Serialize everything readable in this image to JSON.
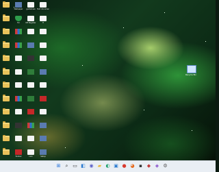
{
  "desktop": {
    "icons": [
      {
        "kind": "folder",
        "label": ""
      },
      {
        "kind": "img",
        "label": "Wallpaper"
      },
      {
        "kind": "doc",
        "label": "guidelines"
      },
      {
        "kind": "doc",
        "label": "Text document"
      },
      {
        "kind": "folder",
        "label": ""
      },
      {
        "kind": "shield",
        "label": "Tor"
      },
      {
        "kind": "doc",
        "label": "KB Register"
      },
      {
        "kind": "doc",
        "label": "H"
      },
      {
        "kind": "folder",
        "label": ""
      },
      {
        "kind": "multi",
        "label": ""
      },
      {
        "kind": "doc",
        "label": ""
      },
      {
        "kind": "doc",
        "label": ""
      },
      {
        "kind": "folder",
        "label": ""
      },
      {
        "kind": "multi",
        "label": ""
      },
      {
        "kind": "img",
        "label": ""
      },
      {
        "kind": "doc",
        "label": ""
      },
      {
        "kind": "folder",
        "label": ""
      },
      {
        "kind": "doc",
        "label": ""
      },
      {
        "kind": "dark",
        "label": ""
      },
      {
        "kind": "doc",
        "label": ""
      },
      {
        "kind": "folder",
        "label": ""
      },
      {
        "kind": "doc",
        "label": ""
      },
      {
        "kind": "green",
        "label": ""
      },
      {
        "kind": "img",
        "label": ""
      },
      {
        "kind": "folder",
        "label": ""
      },
      {
        "kind": "doc",
        "label": ""
      },
      {
        "kind": "doc",
        "label": ""
      },
      {
        "kind": "doc",
        "label": ""
      },
      {
        "kind": "folder",
        "label": ""
      },
      {
        "kind": "multi",
        "label": ""
      },
      {
        "kind": "green",
        "label": ""
      },
      {
        "kind": "red",
        "label": ""
      },
      {
        "kind": "folder",
        "label": ""
      },
      {
        "kind": "doc",
        "label": ""
      },
      {
        "kind": "red",
        "label": ""
      },
      {
        "kind": "doc",
        "label": ""
      },
      {
        "kind": "folder",
        "label": ""
      },
      {
        "kind": "dark",
        "label": ""
      },
      {
        "kind": "multi",
        "label": ""
      },
      {
        "kind": "img",
        "label": ""
      },
      {
        "kind": "folder",
        "label": ""
      },
      {
        "kind": "doc",
        "label": ""
      },
      {
        "kind": "doc",
        "label": ""
      },
      {
        "kind": "img",
        "label": ""
      },
      {
        "kind": "folder",
        "label": ""
      },
      {
        "kind": "red",
        "label": "Toolbar"
      },
      {
        "kind": "doc",
        "label": "Link"
      },
      {
        "kind": "img",
        "label": "Setup"
      }
    ],
    "right_icon": {
      "label": "Recycle Bin",
      "kind": "img"
    }
  },
  "taskbar": {
    "items": [
      {
        "name": "start-icon",
        "glyph": "⊞",
        "color": "#1e6fd9"
      },
      {
        "name": "search-icon",
        "glyph": "⌕",
        "color": "#333333"
      },
      {
        "name": "task-view-icon",
        "glyph": "▭",
        "color": "#333333"
      },
      {
        "name": "widgets-icon",
        "glyph": "◧",
        "color": "#2f7dd1"
      },
      {
        "name": "chat-icon",
        "glyph": "◉",
        "color": "#5b5fc7"
      },
      {
        "name": "file-explorer-icon",
        "glyph": "▰",
        "color": "#e9b83f"
      },
      {
        "name": "edge-icon",
        "glyph": "◐",
        "color": "#1aa06a"
      },
      {
        "name": "store-icon",
        "glyph": "▣",
        "color": "#2f7dd1"
      },
      {
        "name": "chrome-icon",
        "glyph": "●",
        "color": "#d93a2e"
      },
      {
        "name": "firefox-icon",
        "glyph": "◕",
        "color": "#e66b1f"
      },
      {
        "name": "terminal-icon",
        "glyph": "▪",
        "color": "#333333"
      },
      {
        "name": "app-icon",
        "glyph": "◆",
        "color": "#c23a3a"
      },
      {
        "name": "vs-icon",
        "glyph": "◈",
        "color": "#7a3cc7"
      },
      {
        "name": "settings-icon",
        "glyph": "⚙",
        "color": "#555555"
      }
    ]
  }
}
